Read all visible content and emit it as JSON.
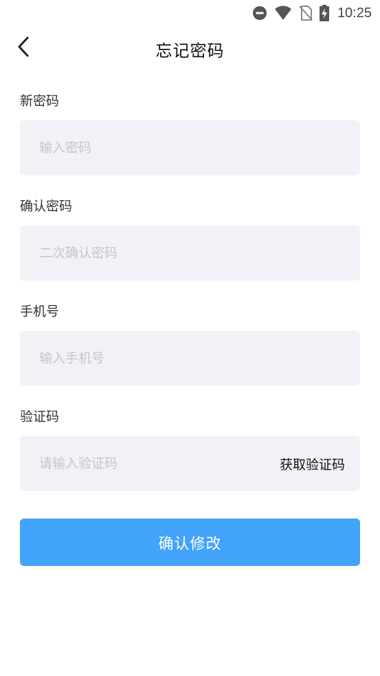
{
  "status_bar": {
    "time": "10:25",
    "icons": [
      "do-not-disturb-icon",
      "wifi-icon",
      "no-sim-icon",
      "battery-charging-icon"
    ]
  },
  "header": {
    "back_icon": "chevron-left-icon",
    "title": "忘记密码"
  },
  "form": {
    "new_password": {
      "label": "新密码",
      "placeholder": "输入密码",
      "value": ""
    },
    "confirm_password": {
      "label": "确认密码",
      "placeholder": "二次确认密码",
      "value": ""
    },
    "phone": {
      "label": "手机号",
      "placeholder": "输入手机号",
      "value": ""
    },
    "code": {
      "label": "验证码",
      "placeholder": "请输入验证码",
      "value": "",
      "get_code_label": "获取验证码"
    }
  },
  "submit": {
    "label": "确认修改",
    "color": "#42a3fb"
  },
  "colors": {
    "field_background": "#f1f2f7",
    "placeholder": "#c4c6cc"
  }
}
